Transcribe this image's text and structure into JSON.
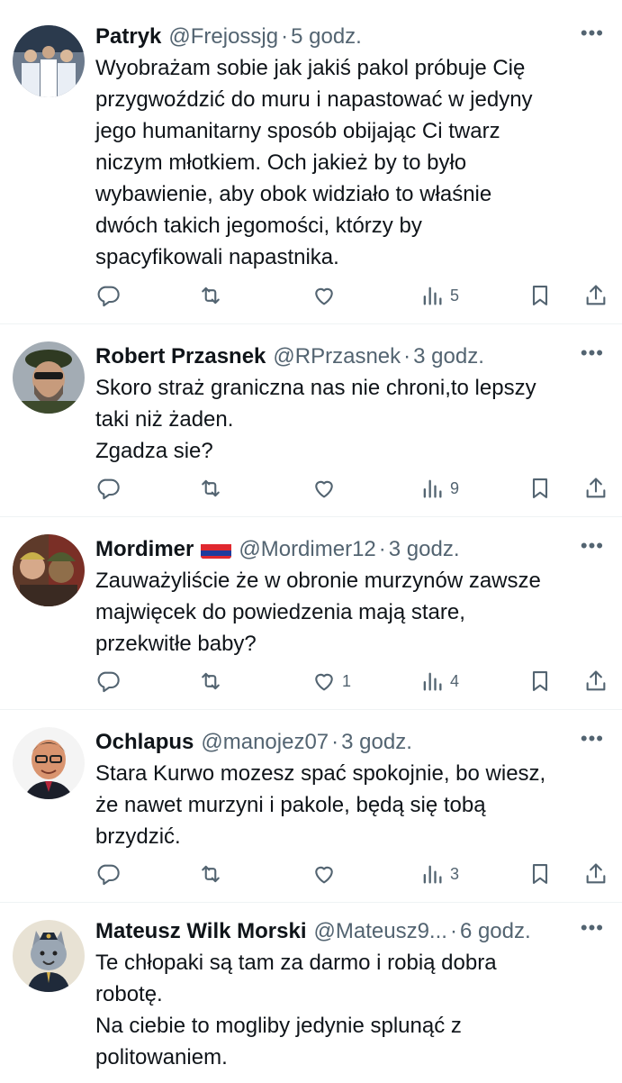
{
  "tweets": [
    {
      "name": "Patryk",
      "handle": "@Frejossjg",
      "time": "5 godz.",
      "text": "Wyobrażam sobie jak jakiś pakol próbuje Cię\nprzygwoździć do muru i napastować w jedyny\njego humanitarny sposób obijając Ci twarz\nniczym młotkiem. Och jakież by to było\nwybawienie, aby obok widziało to właśnie\ndwóch takich jegomości, którzy by\nspacyfikowali napastnika.",
      "likes": "",
      "views": "5"
    },
    {
      "name": "Robert Przasnek",
      "handle": "@RPrzasnek",
      "time": "3 godz.",
      "text": "Skoro straż graniczna nas nie chroni,to lepszy\ntaki niż żaden.\nZgadza sie?",
      "likes": "",
      "views": "9"
    },
    {
      "name": "Mordimer",
      "handle": "@Mordimer12",
      "time": "3 godz.",
      "text": "Zauważyliście że w obronie murzynów zawsze\nmajwięcek do powiedzenia mają stare,\nprzekwitłe baby?",
      "likes": "1",
      "views": "4"
    },
    {
      "name": "Ochlapus",
      "handle": "@manojez07",
      "time": "3 godz.",
      "text": "Stara Kurwo mozesz spać spokojnie, bo wiesz,\nże nawet murzyni i pakole, będą się tobą\nbrzydzić.",
      "likes": "",
      "views": "3"
    },
    {
      "name": "Mateusz Wilk Morski",
      "handle": "@Mateusz9...",
      "time": "6 godz.",
      "text": "Te chłopaki są tam za darmo i robią dobra\nrobotę.\nNa ciebie to mogliby jedynie splunąć z\npolitowaniem.",
      "likes": "",
      "views": ""
    }
  ],
  "more_label": "•••",
  "separator": "·",
  "icons": [
    "reply-icon",
    "retweet-icon",
    "like-icon",
    "views-icon",
    "bookmark-icon",
    "share-icon"
  ],
  "colors": {
    "text": "#0f1419",
    "secondary": "#536471",
    "divider": "#eff3f4",
    "flag_red": "#e0282f",
    "flag_blue": "#1e3c9e"
  }
}
